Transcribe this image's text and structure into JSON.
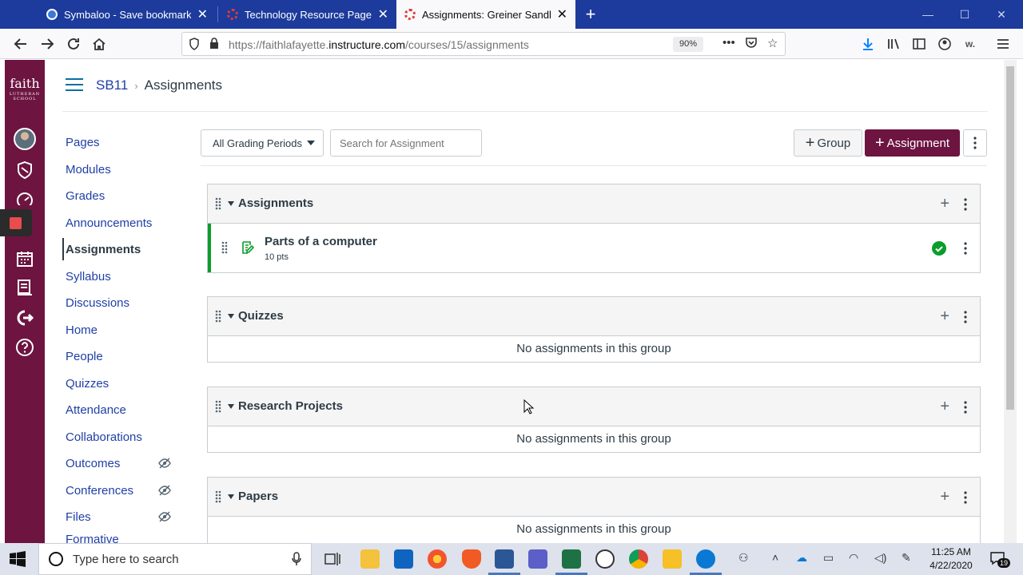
{
  "browser": {
    "tabs": [
      {
        "title": "Symbaloo - Save bookmarks and",
        "icon": "symbaloo-icon",
        "color": "#3b78d8"
      },
      {
        "title": "Technology Resource Page for",
        "icon": "canvas-icon",
        "color": "#e23a3a"
      },
      {
        "title": "Assignments: Greiner Sandbox",
        "icon": "canvas-icon",
        "color": "#e23a3a"
      }
    ],
    "url_prefix": "https://faithlafayette.",
    "url_domain": "instructure.com",
    "url_path": "/courses/15/assignments",
    "zoom": "90%"
  },
  "brand": {
    "logo_text": "faith",
    "logo_sub": "LUTHERAN SCHOOL",
    "nav_color": "#6d1440"
  },
  "breadcrumb": {
    "course": "SB11",
    "page": "Assignments"
  },
  "course_nav": [
    {
      "label": "Pages",
      "active": false,
      "hidden": false
    },
    {
      "label": "Modules",
      "active": false,
      "hidden": false
    },
    {
      "label": "Grades",
      "active": false,
      "hidden": false
    },
    {
      "label": "Announcements",
      "active": false,
      "hidden": false
    },
    {
      "label": "Assignments",
      "active": true,
      "hidden": false
    },
    {
      "label": "Syllabus",
      "active": false,
      "hidden": false
    },
    {
      "label": "Discussions",
      "active": false,
      "hidden": false
    },
    {
      "label": "Home",
      "active": false,
      "hidden": false
    },
    {
      "label": "People",
      "active": false,
      "hidden": false
    },
    {
      "label": "Quizzes",
      "active": false,
      "hidden": false
    },
    {
      "label": "Attendance",
      "active": false,
      "hidden": false
    },
    {
      "label": "Collaborations",
      "active": false,
      "hidden": false
    },
    {
      "label": "Outcomes",
      "active": false,
      "hidden": true
    },
    {
      "label": "Conferences",
      "active": false,
      "hidden": true
    },
    {
      "label": "Files",
      "active": false,
      "hidden": true
    },
    {
      "label": "Formative",
      "active": false,
      "hidden": false
    }
  ],
  "toolbar": {
    "grading_period": "All Grading Periods",
    "search_placeholder": "Search for Assignment",
    "group_button": "Group",
    "assignment_button": "Assignment"
  },
  "groups": [
    {
      "title": "Assignments",
      "assignments": [
        {
          "title": "Parts of a computer",
          "points": "10 pts",
          "published": true
        }
      ],
      "empty_text": ""
    },
    {
      "title": "Quizzes",
      "assignments": [],
      "empty_text": "No assignments in this group"
    },
    {
      "title": "Research Projects",
      "assignments": [],
      "empty_text": "No assignments in this group"
    },
    {
      "title": "Papers",
      "assignments": [],
      "empty_text": "No assignments in this group"
    }
  ],
  "taskbar": {
    "search_placeholder": "Type here to search",
    "time": "11:25 AM",
    "date": "4/22/2020",
    "notifications": "19"
  }
}
